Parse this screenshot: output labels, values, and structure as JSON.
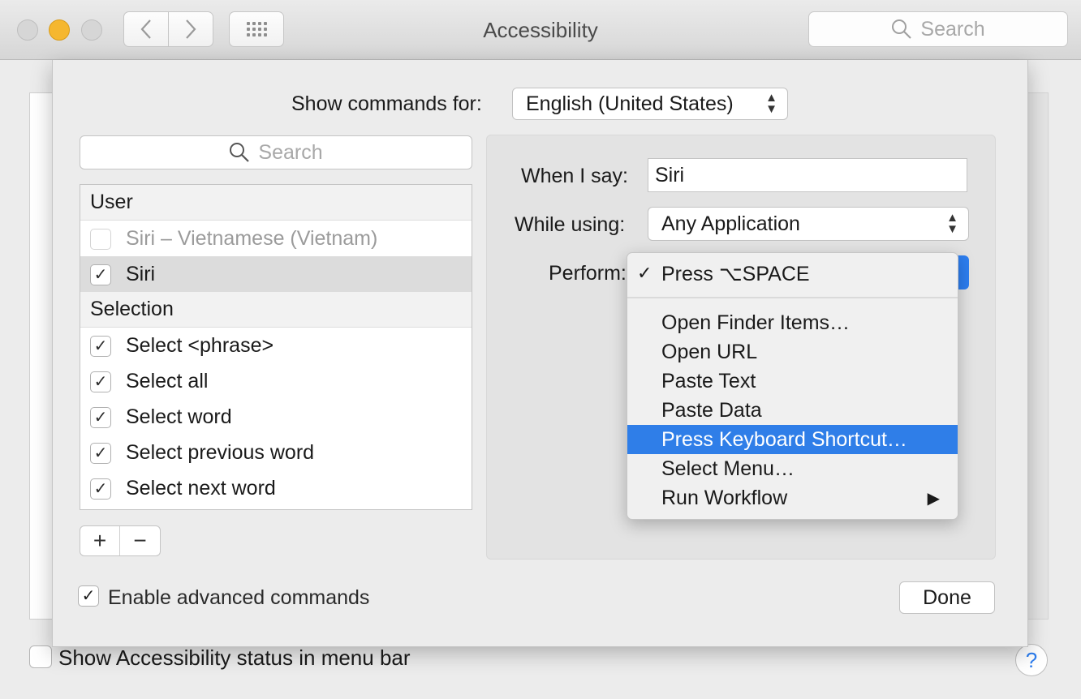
{
  "window": {
    "title": "Accessibility",
    "search_placeholder": "Search"
  },
  "background": {
    "status_checkbox_label": "Show Accessibility status in menu bar",
    "help_label": "?"
  },
  "sheet": {
    "show_commands_for_label": "Show commands for:",
    "language": "English (United States)",
    "list_search_placeholder": "Search",
    "groups": [
      {
        "label": "User",
        "items": [
          {
            "label": "Siri – Vietnamese (Vietnam)",
            "checked": false,
            "disabled": true
          },
          {
            "label": "Siri",
            "checked": true,
            "selected": true
          }
        ]
      },
      {
        "label": "Selection",
        "items": [
          {
            "label": "Select <phrase>",
            "checked": true
          },
          {
            "label": "Select all",
            "checked": true
          },
          {
            "label": "Select word",
            "checked": true
          },
          {
            "label": "Select previous word",
            "checked": true
          },
          {
            "label": "Select next word",
            "checked": true
          }
        ]
      }
    ],
    "add_label": "+",
    "remove_label": "−",
    "enable_advanced_label": "Enable advanced commands",
    "done_label": "Done",
    "detail": {
      "when_label": "When I say:",
      "when_value": "Siri",
      "using_label": "While using:",
      "using_value": "Any Application",
      "perform_label": "Perform:"
    },
    "perform_menu": {
      "current": "Press ⌥SPACE",
      "items": [
        "Open Finder Items…",
        "Open URL",
        "Paste Text",
        "Paste Data",
        "Press Keyboard Shortcut…",
        "Select Menu…",
        "Run Workflow"
      ],
      "highlighted": "Press Keyboard Shortcut…"
    }
  },
  "colors": {
    "accent": "#2f7ee8",
    "minimize": "#f5b72f"
  },
  "icons": {
    "back": "chevron-left-icon",
    "forward": "chevron-right-icon",
    "grid": "grid-icon",
    "search": "search-icon",
    "check": "checkmark-icon",
    "submenu": "triangle-right-icon"
  }
}
